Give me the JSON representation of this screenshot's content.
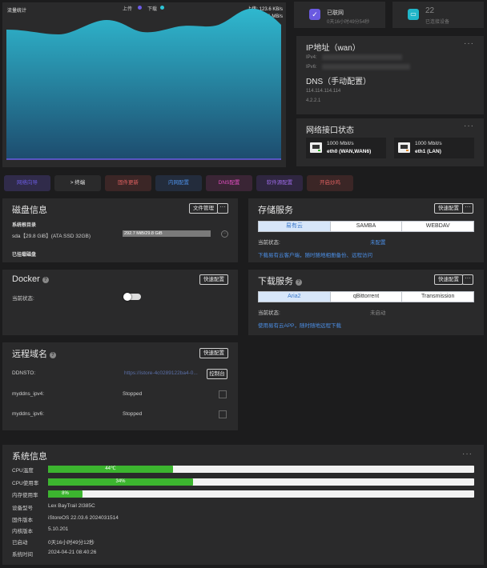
{
  "traffic": {
    "title": "流量统计",
    "legend_up": "上传",
    "legend_down": "下载",
    "up_rate": "上传: 123.6 KB/s",
    "down_rate": "下载: 9.1 MB/s",
    "colors": {
      "up": "#6c5ce7",
      "down": "#2ec4d6"
    }
  },
  "status_cards": [
    {
      "title": "已联网",
      "sub": "0天16小时49分54秒",
      "icon": "check-icon",
      "color": "#6a5ae0"
    },
    {
      "title": "22",
      "sub": "已连接设备",
      "icon": "monitor-icon",
      "color": "#20b6c9"
    }
  ],
  "network": {
    "ip_title": "IP地址（wan）",
    "ipv4_label": "IPv4:",
    "ipv6_label": "IPv6:",
    "dns_title": "DNS（手动配置）",
    "dns1": "114.114.114.114",
    "dns2": "4.2.2.1"
  },
  "iface": {
    "title": "网络接口状态",
    "ports": [
      {
        "speed": "1000 Mbit/s",
        "name": "eth0 (WAN,WAN6)"
      },
      {
        "speed": "1000 Mbit/s",
        "name": "eth1 (LAN)"
      }
    ]
  },
  "quick_buttons": [
    {
      "label": "网络向导",
      "color": "#6a5ae0",
      "bg": "#302b4a"
    },
    {
      "label": "> 终端",
      "color": "#e6e6e6",
      "bg": "#2a2a2b"
    },
    {
      "label": "固件更新",
      "color": "#e06060",
      "bg": "#3b2626"
    },
    {
      "label": "内网配置",
      "color": "#4c8fe6",
      "bg": "#232c3c"
    },
    {
      "label": "DNS配置",
      "color": "#e64fc4",
      "bg": "#3a2535"
    },
    {
      "label": "软件源配置",
      "color": "#9d6be8",
      "bg": "#2f2640"
    },
    {
      "label": "开启炒鸡",
      "color": "#e06060",
      "bg": "#3b2626"
    }
  ],
  "disk": {
    "title": "磁盘信息",
    "manage_btn": "文件管理",
    "system_root": "系统根目录",
    "sda_label": "sda【29.8 GiB】(ATA SSD 32GB)",
    "sda_usage": "292.7 MiB/29.8 GiB",
    "sda_pct": 1,
    "mounted": "已挂载磁盘"
  },
  "storage": {
    "title": "存储服务",
    "btn": "快速配置",
    "tabs": [
      "易有云",
      "SAMBA",
      "WEBDAV"
    ],
    "active": 0,
    "status_label": "当前状态:",
    "status_value": "未配置",
    "link": "下载易有云客户端，随时随地相册备份、远程访问"
  },
  "docker": {
    "title": "Docker",
    "btn": "快速配置",
    "status_label": "当前状态:"
  },
  "download": {
    "title": "下载服务",
    "btn": "快速配置",
    "tabs": [
      "Aria2",
      "qBittorrent",
      "Transmission"
    ],
    "active": 0,
    "status_label": "当前状态:",
    "status_value": "未启动",
    "link": "使用易有云APP，随时随地远程下载"
  },
  "remote": {
    "title": "远程域名",
    "btn": "快速配置",
    "ddnsto_label": "DDNSTO:",
    "ddnsto_url": "https://istore-4c0289122ba4-0...",
    "console_btn": "控制台",
    "rows": [
      {
        "label": "myddns_ipv4:",
        "value": "Stopped"
      },
      {
        "label": "myddns_ipv6:",
        "value": "Stopped"
      }
    ]
  },
  "system": {
    "title": "系统信息",
    "bars": [
      {
        "label": "CPU温度",
        "value": "44℃",
        "pct": 29
      },
      {
        "label": "CPU使用率",
        "value": "34%",
        "pct": 34
      },
      {
        "label": "内存使用率",
        "value": "8%",
        "pct": 8
      }
    ],
    "rows": [
      {
        "label": "设备型号",
        "value": "Lex BayTrail 2I385C"
      },
      {
        "label": "固件版本",
        "value": "iStoreOS 22.03.6 2024031514"
      },
      {
        "label": "内核版本",
        "value": "5.10.201"
      },
      {
        "label": "已启动",
        "value": "0天16小时49分12秒"
      },
      {
        "label": "系统时间",
        "value": "2024-04-21 08:40:26"
      }
    ]
  }
}
